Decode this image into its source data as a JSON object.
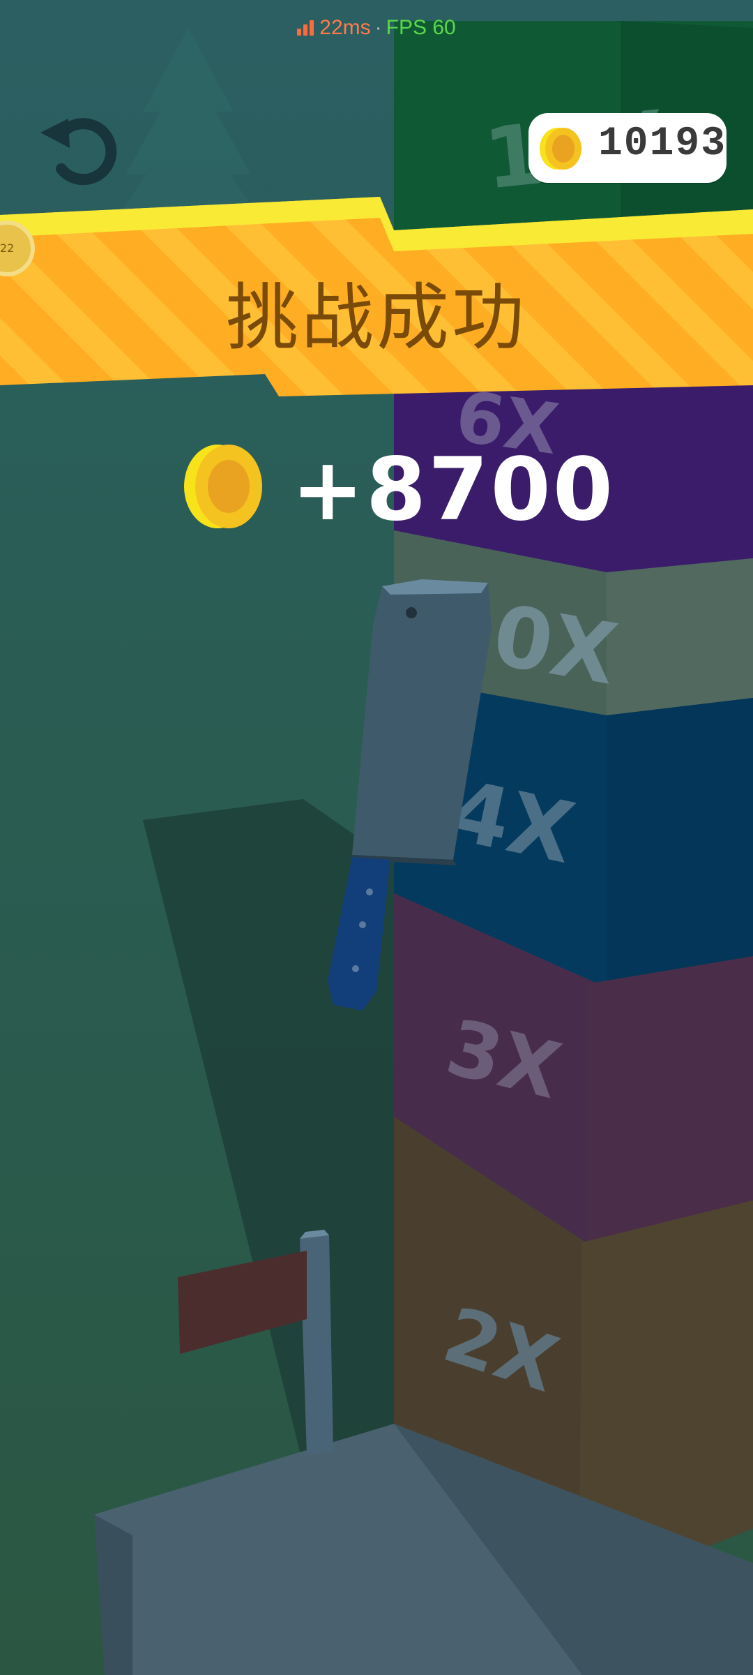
{
  "status": {
    "ping": "22ms",
    "separator": "·",
    "fps": "FPS 60"
  },
  "hud": {
    "coins_total": "10193",
    "restart_icon": "undo-arrow-icon",
    "side_badge": "22"
  },
  "banner": {
    "title": "挑战成功"
  },
  "reward": {
    "amount": "+8700",
    "coin_icon": "gold-coin-icon"
  },
  "tower": {
    "blocks": [
      {
        "label": "10X",
        "color": "#0f5a35"
      },
      {
        "label": "6X",
        "color": "#3b1c6b"
      },
      {
        "label": "20X",
        "color": "#4d6a5e"
      },
      {
        "label": "4X",
        "color": "#043a5e"
      },
      {
        "label": "3X",
        "color": "#4b2d4a"
      },
      {
        "label": "2X",
        "color": "#4d4030"
      }
    ]
  },
  "colors": {
    "banner": "#ffb52e",
    "banner_top": "#f9f33a",
    "coin": "#f6c21c",
    "background": "#2c5c5a"
  }
}
